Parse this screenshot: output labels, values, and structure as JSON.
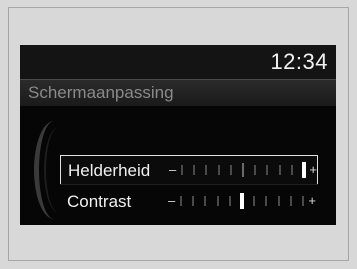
{
  "status_bar": {
    "time": "12:34"
  },
  "screen": {
    "title": "Schermaanpassing"
  },
  "settings": [
    {
      "label": "Helderheid",
      "minus": "–",
      "plus": "+",
      "level": 10,
      "max": 10,
      "selected": true
    },
    {
      "label": "Contrast",
      "minus": "–",
      "plus": "+",
      "level": 5,
      "max": 10,
      "selected": false
    }
  ]
}
